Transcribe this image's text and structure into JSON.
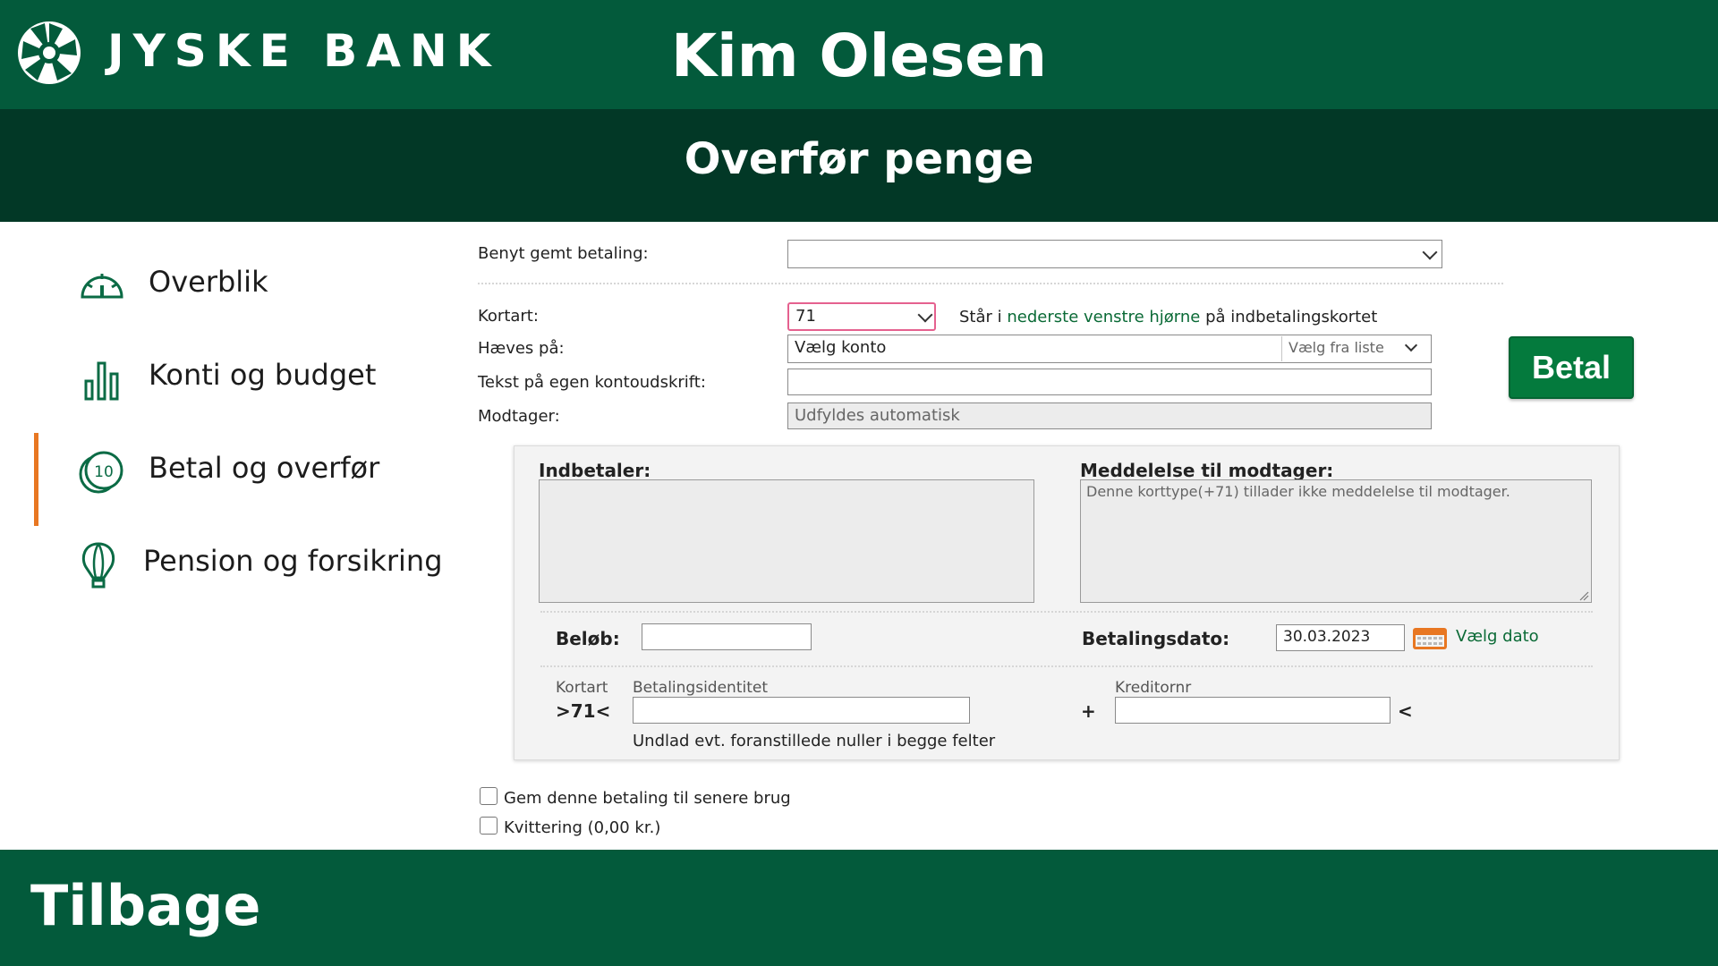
{
  "header": {
    "brand": "JYSKE BANK",
    "logo_icon": "jyske-bank-logo-icon",
    "user_name": "Kim Olesen",
    "page_title": "Overfør penge"
  },
  "colors": {
    "primary_green": "#035a3b",
    "dark_green": "#023826",
    "button_green": "#047a3d",
    "active_accent": "#e87722",
    "link_green": "#0a6a36"
  },
  "sidebar": {
    "items": [
      {
        "label": "Overblik",
        "icon": "gauge-icon",
        "active": false
      },
      {
        "label": "Konti og budget",
        "icon": "bar-chart-icon",
        "active": false
      },
      {
        "label": "Betal og overfør",
        "icon": "coins-icon",
        "active": true
      },
      {
        "label": "Pension og forsikring",
        "icon": "hot-air-balloon-icon",
        "active": false
      }
    ]
  },
  "form": {
    "saved_payment_label": "Benyt gemt betaling:",
    "saved_payment_value": "",
    "card_type_label": "Kortart:",
    "card_type_value": "71",
    "card_hint_pre": "Står i",
    "card_hint_link": "nederste venstre hjørne",
    "card_hint_post": "på indbetalingskortet",
    "withdraw_label": "Hæves på:",
    "withdraw_value": "Vælg konto",
    "withdraw_select": "Vælg fra liste",
    "own_text_label": "Tekst på egen kontoudskrift:",
    "own_text_value": "",
    "recipient_label": "Modtager:",
    "recipient_placeholder": "Udfyldes automatisk",
    "pay_button": "Betal"
  },
  "panel": {
    "payer_label": "Indbetaler:",
    "message_label": "Meddelelse til modtager:",
    "message_text": "Denne korttype(+71) tillader ikke meddelelse til modtager.",
    "amount_label": "Beløb:",
    "amount_value": "",
    "date_label": "Betalingsdato:",
    "date_value": "30.03.2023",
    "choose_date": "Vælg dato",
    "card_type_small": "Kortart",
    "card_type_code": ">71<",
    "payment_id_label": "Betalingsidentitet",
    "payment_id_value": "",
    "plus_sign": "+",
    "creditor_label": "Kreditornr",
    "creditor_value": "",
    "less_than": "<",
    "hint": "Undlad evt. foranstillede nuller i begge felter"
  },
  "options": {
    "save_payment": "Gem denne betaling til senere brug",
    "save_payment_checked": false,
    "receipt": "Kvittering (0,00 kr.)",
    "receipt_checked": false
  },
  "footer": {
    "back_label": "Tilbage"
  }
}
